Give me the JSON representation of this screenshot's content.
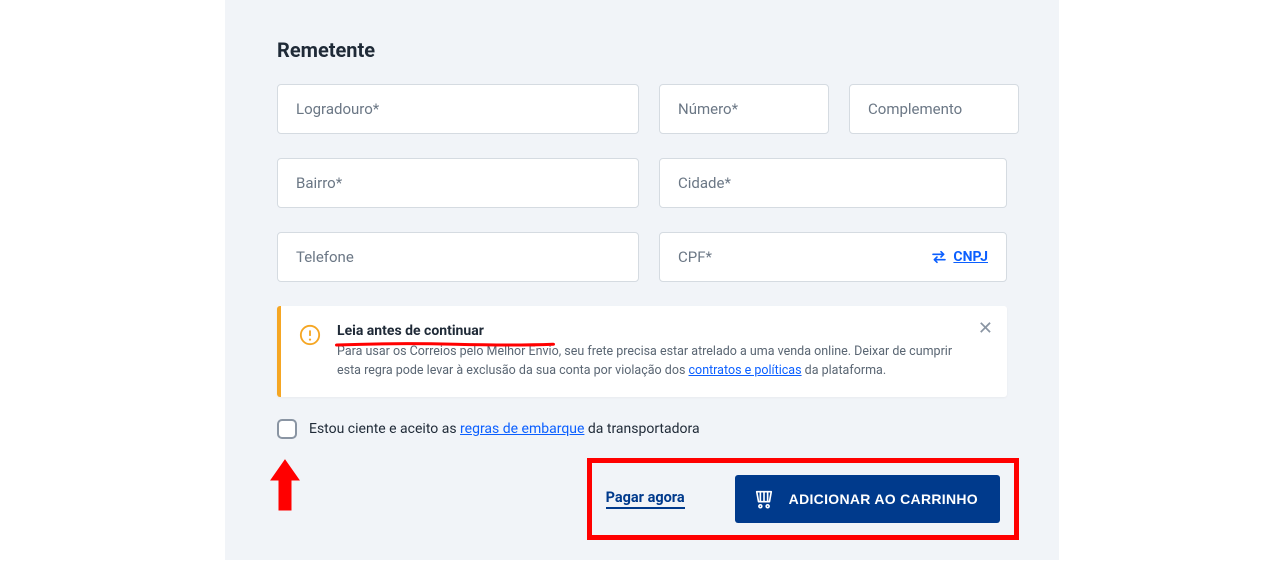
{
  "section_title": "Remetente",
  "fields": {
    "logradouro": {
      "placeholder": "Logradouro*"
    },
    "numero": {
      "placeholder": "Número*"
    },
    "complemento": {
      "placeholder": "Complemento"
    },
    "bairro": {
      "placeholder": "Bairro*"
    },
    "cidade": {
      "placeholder": "Cidade*"
    },
    "telefone": {
      "placeholder": "Telefone"
    },
    "cpf": {
      "placeholder": "CPF*"
    }
  },
  "swap_label": "CNPJ",
  "alert": {
    "title": "Leia antes de continuar",
    "text_before": "Para usar os Correios pelo Melhor Envio, seu frete precisa estar atrelado a uma venda online. Deixar de cumprir esta regra pode levar à exclusão da sua conta por violação dos ",
    "link": "contratos e políticas",
    "text_after": " da plataforma."
  },
  "consent": {
    "text_before": "Estou ciente e aceito as ",
    "link": "regras de embarque",
    "text_after": " da transportadora"
  },
  "actions": {
    "pay_now": "Pagar agora",
    "add_to_cart": "ADICIONAR AO CARRINHO"
  }
}
